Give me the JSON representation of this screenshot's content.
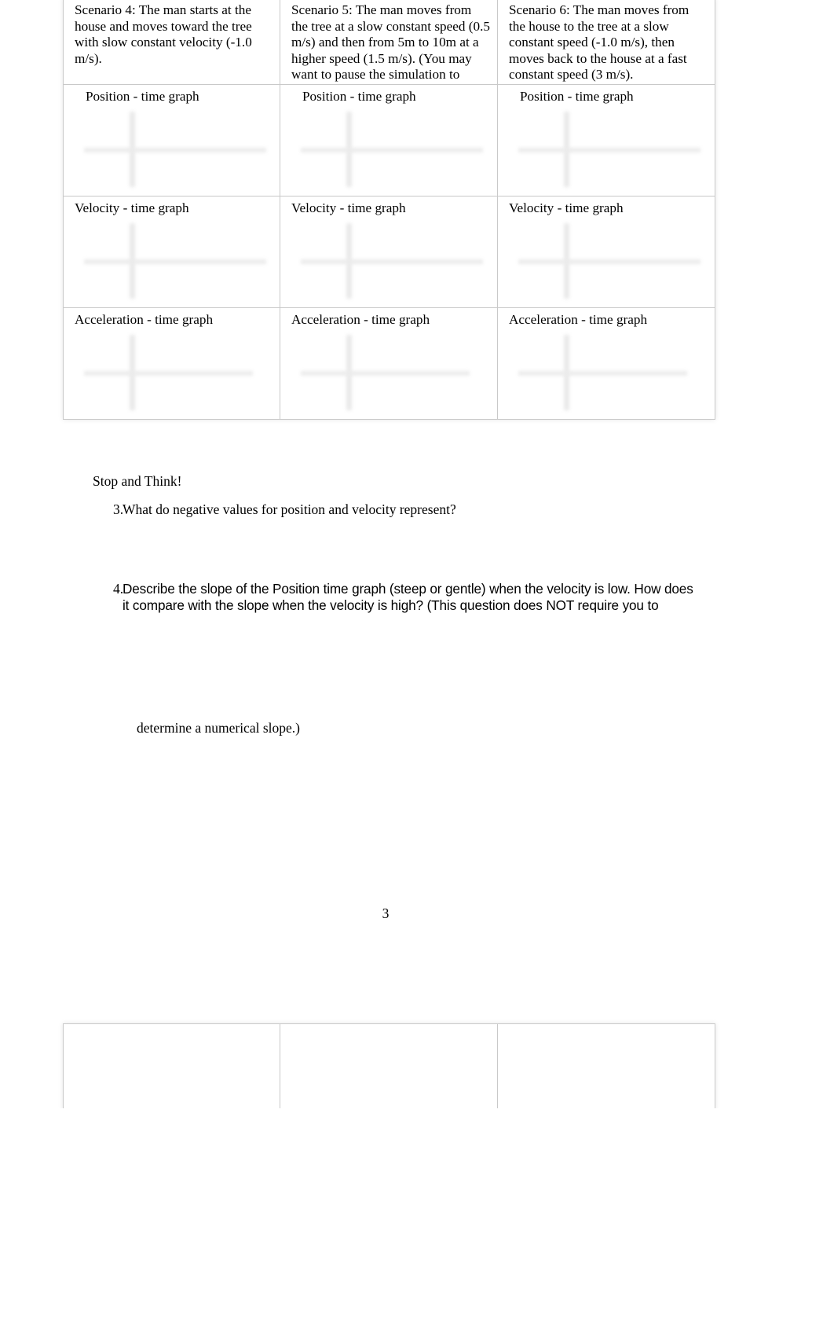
{
  "document": {
    "page_number": "3",
    "scenarios": [
      {
        "id": "scenario-4",
        "description": "Scenario 4:   The man starts at the house and moves toward the tree with slow constant velocity (-1.0 m/s).",
        "graphs": [
          {
            "label": "Position - time graph",
            "type": "position-time"
          },
          {
            "label": "Velocity - time graph",
            "type": "velocity-time"
          },
          {
            "label": "Acceleration - time graph",
            "type": "acceleration-time"
          }
        ]
      },
      {
        "id": "scenario-5",
        "description": "Scenario 5:   The man moves from the tree at a slow constant speed (0.5 m/s) and then from 5m to 10m at a higher speed (1.5 m/s).  (You may want to pause the simulation to change the velocity values.)",
        "graphs": [
          {
            "label": "Position - time graph",
            "type": "position-time"
          },
          {
            "label": "Velocity - time graph",
            "type": "velocity-time"
          },
          {
            "label": "Acceleration - time graph",
            "type": "acceleration-time"
          }
        ]
      },
      {
        "id": "scenario-6",
        "description": "Scenario 6:   The man moves from the house to the tree at a slow constant speed (-1.0 m/s), then moves back to the house at a fast constant speed (3 m/s).",
        "graphs": [
          {
            "label": "Position - time graph",
            "type": "position-time"
          },
          {
            "label": "Velocity - time graph",
            "type": "velocity-time"
          },
          {
            "label": "Acceleration - time graph",
            "type": "acceleration-time"
          }
        ]
      }
    ],
    "stop_and_think": {
      "heading": "Stop and Think!",
      "questions": [
        {
          "number": "3.",
          "text": "What do negative values for position and velocity represent?"
        },
        {
          "number": "4.",
          "text": "Describe the slope of the Position  time graph (steep or gentle) when the velocity is low. How does it compare with the slope when the velocity is high? (This question does NOT require you to",
          "continuation": "determine a numerical slope.)"
        }
      ]
    }
  }
}
